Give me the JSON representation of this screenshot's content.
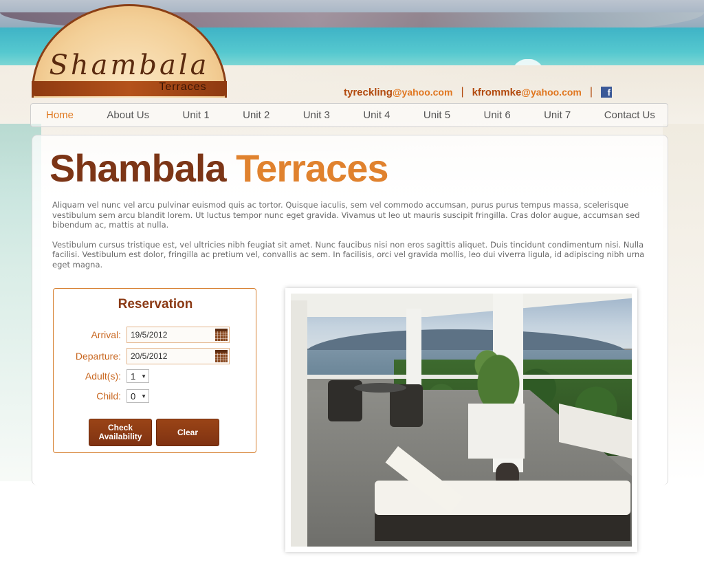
{
  "logo": {
    "title": "Shambala",
    "subtitle": "Terraces"
  },
  "contacts": {
    "emails": [
      {
        "user": "tyreckling",
        "domain": "@yahoo.com"
      },
      {
        "user": "kfrommke",
        "domain": "@yahoo.com"
      }
    ],
    "separator": "|",
    "facebook_label": "f",
    "facebook_icon": "facebook-icon"
  },
  "nav": {
    "items": [
      "Home",
      "About Us",
      "Unit 1",
      "Unit 2",
      "Unit 3",
      "Unit 4",
      "Unit 5",
      "Unit 6",
      "Unit 7",
      "Contact Us"
    ],
    "active_index": 0
  },
  "main": {
    "title_part1": "Shambala",
    "title_part2": "Terraces",
    "paragraphs": [
      "Aliquam vel nunc vel arcu pulvinar euismod quis ac tortor. Quisque iaculis, sem vel commodo accumsan, purus purus tempus massa, scelerisque vestibulum sem arcu blandit lorem. Ut luctus tempor nunc eget gravida. Vivamus ut leo ut mauris suscipit fringilla. Cras dolor augue, accumsan sed bibendum ac, mattis at nulla.",
      "Vestibulum cursus tristique est, vel ultricies nibh feugiat sit amet. Nunc faucibus nisi non eros sagittis aliquet. Duis tincidunt condimentum nisi. Nulla facilisi. Vestibulum est dolor, fringilla ac pretium vel, convallis ac sem. In facilisis, orci vel gravida mollis, leo dui viverra ligula, id adipiscing nibh urna eget magna."
    ]
  },
  "reservation": {
    "title": "Reservation",
    "arrival_label": "Arrival:",
    "arrival_value": "19/5/2012",
    "departure_label": "Departure:",
    "departure_value": "20/5/2012",
    "adults_label": "Adult(s):",
    "adults_value": "1",
    "child_label": "Child:",
    "child_value": "0",
    "check_button": "Check\nAvailability",
    "clear_button": "Clear"
  },
  "colors": {
    "brand_dark": "#7c3516",
    "brand_accent": "#e0822e",
    "button_bg": "#8a3a14"
  }
}
